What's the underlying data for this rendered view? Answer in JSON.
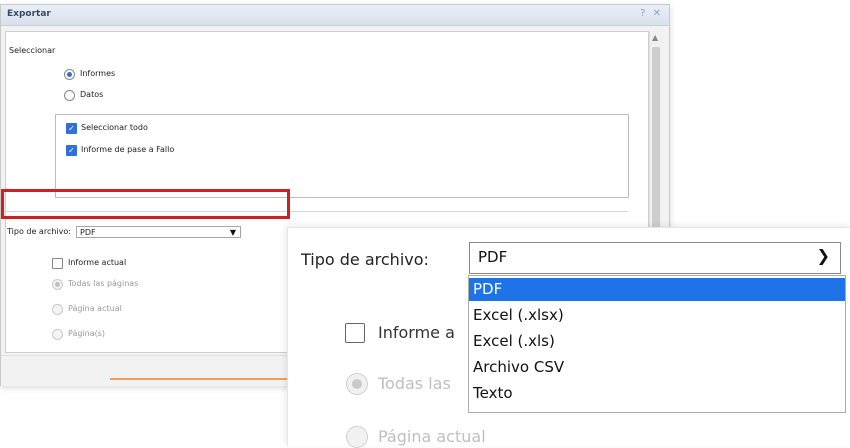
{
  "dialog": {
    "title": "Exportar",
    "title_icons": [
      "help-icon",
      "close-icon"
    ],
    "section_label": "Seleccionar",
    "radio_options": [
      {
        "label": "Informes",
        "checked": true
      },
      {
        "label": "Datos",
        "checked": false
      }
    ],
    "checkbox_items": [
      {
        "label": "Seleccionar todo",
        "checked": true
      },
      {
        "label": "Informe de pase a Fallo",
        "checked": true
      }
    ],
    "file_type_label": "Tipo de archivo:",
    "file_type_value": "PDF",
    "current_report_label": "Informe actual",
    "page_options": [
      {
        "label": "Todas las páginas",
        "checked": true,
        "disabled": true
      },
      {
        "label": "Página actual",
        "checked": false,
        "disabled": true
      },
      {
        "label": "Página(s)",
        "checked": false,
        "disabled": true
      }
    ]
  },
  "zoom": {
    "file_type_label": "Tipo de archivo:",
    "selected_value": "PDF",
    "dropdown_options": [
      "PDF",
      "Excel (.xlsx)",
      "Excel (.xls)",
      "Archivo CSV",
      "Texto"
    ],
    "selected_index": 0,
    "current_report_label_partial": "Informe a",
    "all_pages_label_partial": "Todas las",
    "current_page_label_partial": "Página actual"
  },
  "colors": {
    "highlight": "#d11f1f",
    "accent_blue": "#1e73e8"
  }
}
